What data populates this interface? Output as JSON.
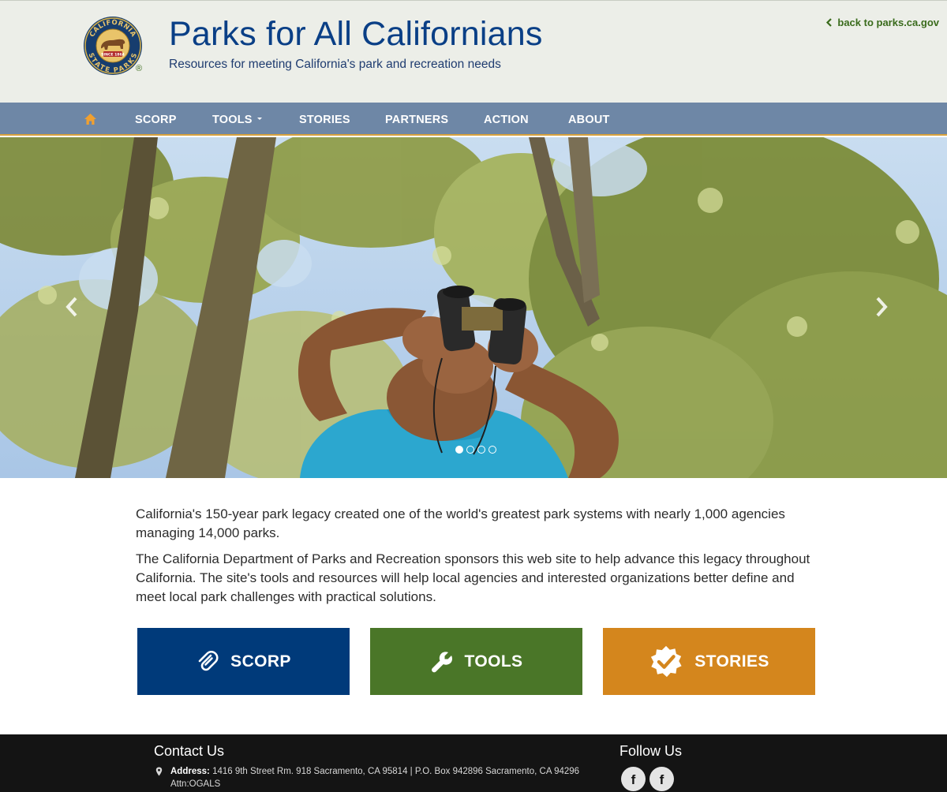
{
  "header": {
    "title": "Parks for All Californians",
    "subtitle": "Resources for meeting California's park and recreation needs",
    "back_link": "back to parks.ca.gov",
    "logo": {
      "top_text": "CALIFORNIA",
      "bottom_text": "STATE PARKS",
      "since": "SINCE 1864",
      "registered": "®"
    }
  },
  "nav": {
    "home_icon": "home-icon",
    "items": [
      {
        "label": "SCORP"
      },
      {
        "label": "TOOLS"
      },
      {
        "label": "STORIES"
      },
      {
        "label": "PARTNERS"
      },
      {
        "label": "ACTION"
      },
      {
        "label": "ABOUT"
      }
    ]
  },
  "carousel": {
    "slide_count": 4,
    "active_slide": 1,
    "prev_icon": "chevron-left-icon",
    "next_icon": "chevron-right-icon"
  },
  "intro": {
    "p1": "California's 150-year park legacy created one of the world's greatest park systems with nearly 1,000 agencies managing 14,000 parks.",
    "p2": "The California Department of Parks and Recreation sponsors this web site to help advance this legacy throughout California. The site's tools and resources will help local agencies and interested organizations better define and meet local park challenges with practical solutions."
  },
  "features": [
    {
      "label": "SCORP",
      "icon": "paperclip-icon",
      "color": "#003a7a"
    },
    {
      "label": "TOOLS",
      "icon": "wrench-icon",
      "color": "#4a7628"
    },
    {
      "label": "STORIES",
      "icon": "badge-check-icon",
      "color": "#d4861d"
    }
  ],
  "footer": {
    "contact_title": "Contact Us",
    "address_label": "Address:",
    "address_value": "1416 9th Street Rm. 918 Sacramento, CA 95814 | P.O. Box 942896 Sacramento, CA 94296 Attn:OGALS",
    "follow_title": "Follow Us",
    "social": [
      {
        "label": "f",
        "icon": "facebook-icon"
      },
      {
        "label": "f",
        "icon": "facebook-icon"
      }
    ]
  },
  "colors": {
    "header_bg": "#eceee8",
    "title": "#0a3f86",
    "nav_bg": "#6e87a6",
    "nav_accent": "#d8a23d",
    "home_icon": "#f0a030",
    "back_link": "#3a6b1c",
    "footer_bg": "#141414"
  }
}
